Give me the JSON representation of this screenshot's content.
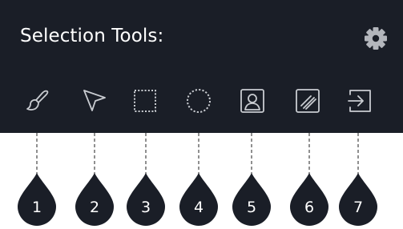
{
  "panel": {
    "title": "Selection Tools:",
    "background": "#1a1e27",
    "settings_icon": "gear-icon",
    "tools": [
      {
        "name": "brush-tool-button",
        "icon": "brush-icon"
      },
      {
        "name": "pointer-tool-button",
        "icon": "cursor-arrow-icon"
      },
      {
        "name": "rectangle-select-button",
        "icon": "dotted-rectangle-icon"
      },
      {
        "name": "ellipse-select-button",
        "icon": "dotted-circle-icon"
      },
      {
        "name": "person-select-button",
        "icon": "person-portrait-icon"
      },
      {
        "name": "hatch-select-button",
        "icon": "hatched-square-icon"
      },
      {
        "name": "exit-tool-button",
        "icon": "enter-arrow-icon"
      }
    ]
  },
  "callouts": {
    "labels": [
      "1",
      "2",
      "3",
      "4",
      "5",
      "6",
      "7"
    ],
    "marker_color": "#1a1e27",
    "line_color": "#555555"
  }
}
